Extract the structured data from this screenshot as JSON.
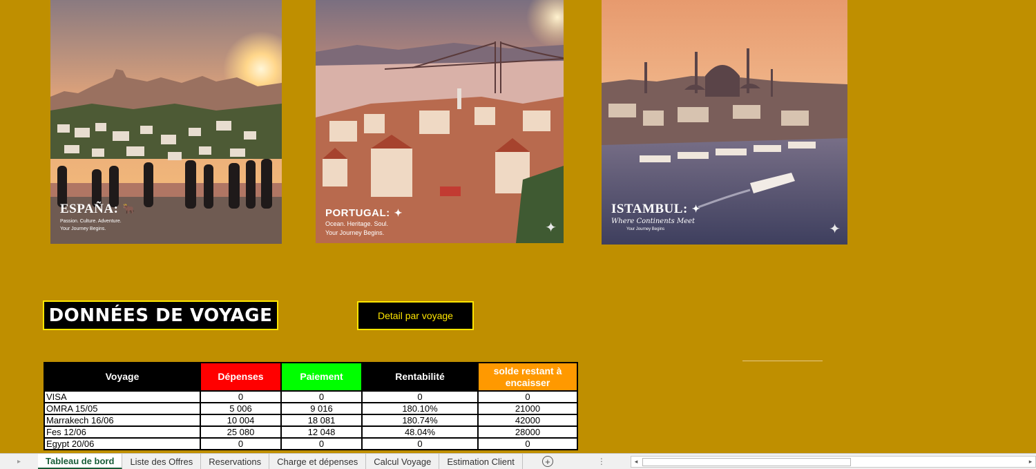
{
  "posters": [
    {
      "title": "ESPAÑA:",
      "sub1": "Passion. Culture. Adventure.",
      "sub2": "Your Journey Begins.",
      "icon": "bull-icon"
    },
    {
      "title": "PORTUGAL:",
      "sub1": "Ocean. Heritage. Soul.",
      "sub2": "Your Journey Begins.",
      "icon": "star-icon"
    },
    {
      "title": "ISTAMBUL:",
      "script": "Where Continents Meet",
      "sub2": "Your Journey Begins",
      "icon": "star-icon"
    }
  ],
  "heading": "DONNÉES DE VOYAGE",
  "detail_button": "Detail par voyage",
  "table": {
    "headers": [
      "Voyage",
      "Dépenses",
      "Paiement",
      "Rentabilité",
      "solde restant à encaisser"
    ],
    "rows": [
      [
        "VISA",
        "0",
        "0",
        "0",
        "0"
      ],
      [
        "OMRA 15/05",
        "5 006",
        "9 016",
        "180.10%",
        "21000"
      ],
      [
        "Marrakech 16/06",
        "10 004",
        "18 081",
        "180.74%",
        "42000"
      ],
      [
        "Fes 12/06",
        "25 080",
        "12 048",
        "48.04%",
        "28000"
      ],
      [
        "Egypt 20/06",
        "0",
        "0",
        "0",
        "0"
      ]
    ]
  },
  "sheet_tabs": [
    "Tableau de bord",
    "Liste des Offres",
    "Reservations",
    "Charge et dépenses",
    "Calcul Voyage",
    "Estimation Client"
  ],
  "active_tab": "Tableau de bord",
  "colors": {
    "background": "#bf8f00",
    "accent_border": "#ffe600",
    "depenses": "#ff0000",
    "paiement": "#00ff00",
    "solde": "#ff9900"
  }
}
